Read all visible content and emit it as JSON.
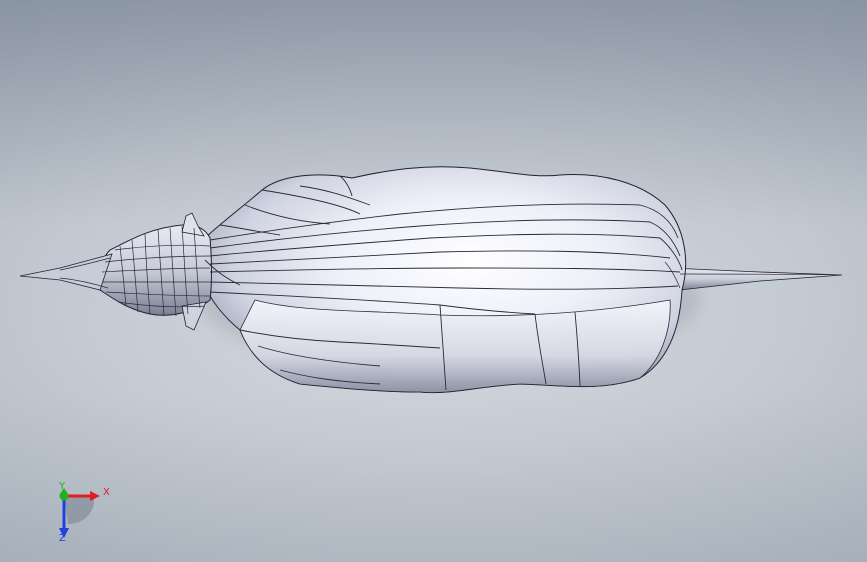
{
  "viewport": {
    "background_top": "#8f99a6",
    "background_center": "#d9dde3"
  },
  "model": {
    "icon": "fuselage-surface-model",
    "surface_color": "#eef0f8",
    "edge_color": "#1e1e28"
  },
  "triad": {
    "x_label": "X",
    "y_label": "Y",
    "z_label": "Z",
    "x_color": "#e02020",
    "y_color": "#20b020",
    "z_color": "#2040e0"
  }
}
